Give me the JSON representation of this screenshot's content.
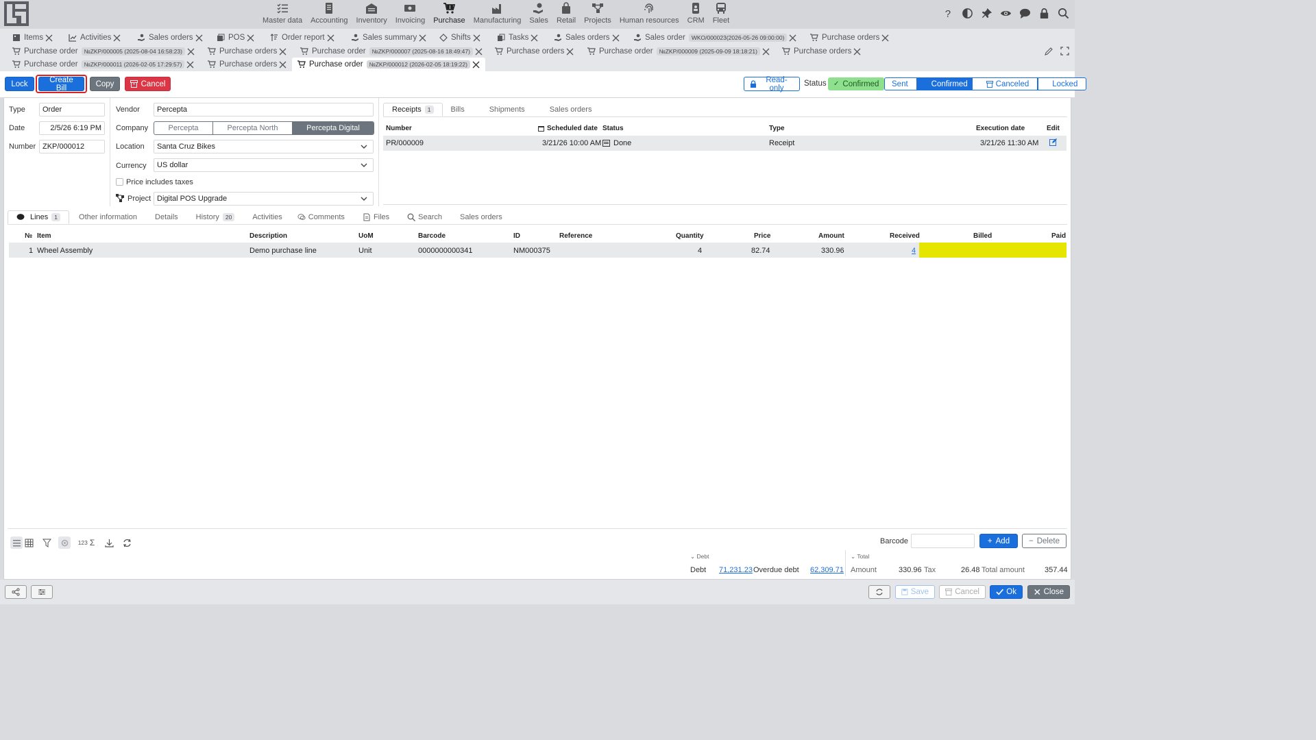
{
  "topnav": {
    "modules": [
      {
        "label": "Master data",
        "icon": "list-check-icon"
      },
      {
        "label": "Accounting",
        "icon": "ledger-icon"
      },
      {
        "label": "Inventory",
        "icon": "warehouse-icon"
      },
      {
        "label": "Invoicing",
        "icon": "cash-icon"
      },
      {
        "label": "Purchase",
        "icon": "cart-icon"
      },
      {
        "label": "Manufacturing",
        "icon": "factory-icon"
      },
      {
        "label": "Sales",
        "icon": "hand-coin-icon"
      },
      {
        "label": "Retail",
        "icon": "bag-icon"
      },
      {
        "label": "Projects",
        "icon": "project-icon"
      },
      {
        "label": "Human resources",
        "icon": "fingerprint-icon"
      },
      {
        "label": "CRM",
        "icon": "phone-icon"
      },
      {
        "label": "Fleet",
        "icon": "bus-icon"
      }
    ],
    "active_module": "Purchase",
    "right_icons": [
      "help-icon",
      "contrast-icon",
      "pin-icon",
      "eye-icon",
      "chat-icon",
      "lock-icon",
      "search-icon"
    ]
  },
  "tabs": {
    "row1": [
      {
        "label": "Items",
        "badge": ""
      },
      {
        "label": "Activities",
        "badge": ""
      },
      {
        "label": "Sales orders",
        "badge": ""
      },
      {
        "label": "POS",
        "badge": ""
      },
      {
        "label": "Order report",
        "badge": ""
      },
      {
        "label": "Sales summary",
        "badge": ""
      },
      {
        "label": "Shifts",
        "badge": ""
      },
      {
        "label": "Tasks",
        "badge": ""
      },
      {
        "label": "Sales orders",
        "badge": ""
      },
      {
        "label": "Sales order",
        "badge": "WKO/000023(2026-05-26 09:00:00)"
      },
      {
        "label": "Purchase orders",
        "badge": ""
      }
    ],
    "row2": [
      {
        "label": "Purchase order",
        "badge": "№ZKP/000005 (2025-08-04 16:58:23)"
      },
      {
        "label": "Purchase orders",
        "badge": ""
      },
      {
        "label": "Purchase order",
        "badge": "№ZKP/000007 (2025-08-16 18:49:47)"
      },
      {
        "label": "Purchase orders",
        "badge": ""
      },
      {
        "label": "Purchase order",
        "badge": "№ZKP/000009 (2025-09-09 18:18:21)"
      },
      {
        "label": "Purchase orders",
        "badge": ""
      }
    ],
    "row3": [
      {
        "label": "Purchase order",
        "badge": "№ZKP/000011 (2026-02-05 17:29:57)"
      },
      {
        "label": "Purchase orders",
        "badge": ""
      },
      {
        "label": "Purchase order",
        "badge": "№ZKP/000012 (2026-02-05 18:19:22)"
      }
    ]
  },
  "toolbar": {
    "lock": "Lock",
    "create_bill": "Create Bill",
    "copy": "Copy",
    "cancel": "Cancel",
    "read_only": "Read-only",
    "status_label": "Status",
    "status_value": "Confirmed",
    "workflow": [
      "Sent",
      "Confirmed",
      "Canceled",
      "Locked"
    ]
  },
  "header": {
    "type_label": "Type",
    "type_value": "Order",
    "date_label": "Date",
    "date_value": "2/5/26 6:19 PM",
    "number_label": "Number",
    "number_value": "ZKP/000012",
    "vendor_label": "Vendor",
    "vendor_value": "Percepta",
    "company_label": "Company",
    "companies": [
      "Percepta",
      "Percepta North",
      "Percepta Digital"
    ],
    "location_label": "Location",
    "location_value": "Santa Cruz Bikes",
    "currency_label": "Currency",
    "currency_value": "US dollar",
    "price_taxes_label": "Price includes taxes",
    "project_label": "Project",
    "project_value": "Digital POS Upgrade"
  },
  "right_tabs": {
    "tabs": [
      {
        "label": "Receipts",
        "badge": "1"
      },
      {
        "label": "Bills",
        "badge": ""
      },
      {
        "label": "Shipments",
        "badge": ""
      },
      {
        "label": "Sales orders",
        "badge": ""
      }
    ],
    "columns": [
      "Number",
      "Scheduled date",
      "Status",
      "Type",
      "Execution date",
      "Edit"
    ],
    "rows": [
      {
        "number": "PR/000009",
        "scheduled": "3/21/26 10:00 AM",
        "status": "Done",
        "type": "Receipt",
        "executed": "3/21/26 11:30 AM"
      }
    ]
  },
  "lines_tabs": [
    {
      "label": "Lines",
      "badge": "1"
    },
    {
      "label": "Other information",
      "badge": ""
    },
    {
      "label": "Details",
      "badge": ""
    },
    {
      "label": "History",
      "badge": "20"
    },
    {
      "label": "Activities",
      "badge": ""
    },
    {
      "label": "Comments",
      "badge": ""
    },
    {
      "label": "Files",
      "badge": ""
    },
    {
      "label": "Search",
      "badge": ""
    },
    {
      "label": "Sales orders",
      "badge": ""
    }
  ],
  "lines": {
    "columns": {
      "no": "№",
      "item": "Item",
      "description": "Description",
      "uom": "UoM",
      "barcode": "Barcode",
      "id": "ID",
      "reference": "Reference",
      "quantity": "Quantity",
      "price": "Price",
      "amount": "Amount",
      "received": "Received",
      "billed": "Billed",
      "paid": "Paid"
    },
    "rows": [
      {
        "no": "1",
        "item": "Wheel Assembly",
        "description": "Demo purchase line",
        "uom": "Unit",
        "barcode": "0000000000341",
        "id": "NM000375",
        "reference": "",
        "quantity": "4",
        "price": "82.74",
        "amount": "330.96",
        "received": "4",
        "billed": "",
        "paid": ""
      }
    ],
    "highlight_color": "#e5e500"
  },
  "footer": {
    "barcode_label": "Barcode",
    "add": "Add",
    "delete": "Delete",
    "sum_label": "123",
    "debt_header": "Debt",
    "debt_label": "Debt",
    "debt_value": "71,231.23",
    "overdue_label": "Overdue debt",
    "overdue_value": "62,309.71",
    "total_header": "Total",
    "amount_label": "Amount",
    "amount_value": "330.96",
    "tax_label": "Tax",
    "tax_value": "26.48",
    "total_label": "Total amount",
    "total_value": "357.44"
  },
  "bottombar": {
    "save": "Save",
    "cancel": "Cancel",
    "ok": "Ok",
    "close": "Close"
  }
}
